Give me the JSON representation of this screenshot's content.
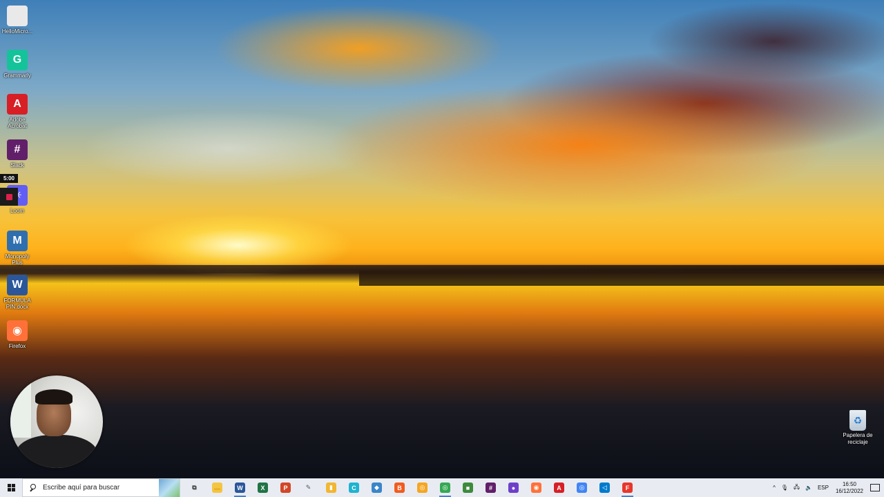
{
  "desktop": {
    "icons": [
      {
        "label": "HelloMicro...",
        "glyph": "",
        "color": "#e9e9e9",
        "icon": "file-icon"
      },
      {
        "label": "Grammarly",
        "glyph": "G",
        "color": "#15c39a",
        "icon": "grammarly-icon"
      },
      {
        "label": "Adobe Acrobat",
        "glyph": "A",
        "color": "#d81f26",
        "icon": "adobe-acrobat-icon"
      },
      {
        "label": "Slack",
        "glyph": "#",
        "color": "#611f69",
        "icon": "slack-icon"
      },
      {
        "label": "Loom",
        "glyph": "✳",
        "color": "#625df5",
        "icon": "loom-icon"
      },
      {
        "label": "Monopoly Plus",
        "glyph": "M",
        "color": "#2f6fb0",
        "icon": "monopoly-icon"
      },
      {
        "label": "FORMULA PIN.docx",
        "glyph": "W",
        "color": "#2b579a",
        "icon": "word-document-icon"
      },
      {
        "label": "Firefox",
        "glyph": "◉",
        "color": "#ff7139",
        "icon": "firefox-icon"
      }
    ],
    "recycle_bin": {
      "label": "Papelera de reciclaje",
      "icon": "recycle-bin-icon"
    },
    "loom_timer": "5:00"
  },
  "taskbar": {
    "search_placeholder": "Escribe aquí para buscar",
    "apps": [
      {
        "name": "task-view",
        "glyph": "⧉",
        "color": "#333",
        "bg": "transparent",
        "icon": "task-view-icon"
      },
      {
        "name": "file-explorer",
        "glyph": "▬",
        "color": "#e8b12a",
        "bg": "#f4c542",
        "icon": "folder-icon"
      },
      {
        "name": "word",
        "glyph": "W",
        "color": "#fff",
        "bg": "#2b579a",
        "icon": "word-icon",
        "active": true
      },
      {
        "name": "excel",
        "glyph": "X",
        "color": "#fff",
        "bg": "#217346",
        "icon": "excel-icon"
      },
      {
        "name": "powerpoint",
        "glyph": "P",
        "color": "#fff",
        "bg": "#d24726",
        "icon": "powerpoint-icon"
      },
      {
        "name": "tool",
        "glyph": "✎",
        "color": "#555",
        "bg": "transparent",
        "icon": "hammer-icon"
      },
      {
        "name": "notes",
        "glyph": "▮",
        "color": "#fff",
        "bg": "#f2b632",
        "icon": "notes-icon"
      },
      {
        "name": "canva",
        "glyph": "C",
        "color": "#fff",
        "bg": "#1fb3d1",
        "icon": "canva-icon"
      },
      {
        "name": "app-blue",
        "glyph": "◆",
        "color": "#fff",
        "bg": "#3a86c8",
        "icon": "app-icon"
      },
      {
        "name": "brave",
        "glyph": "B",
        "color": "#fff",
        "bg": "#f25b1f",
        "icon": "brave-icon"
      },
      {
        "name": "chrome-canary",
        "glyph": "◎",
        "color": "#fff",
        "bg": "#f4a623",
        "icon": "chrome-canary-icon"
      },
      {
        "name": "chrome",
        "glyph": "◎",
        "color": "#fff",
        "bg": "#34a853",
        "icon": "chrome-icon",
        "active": true
      },
      {
        "name": "cube",
        "glyph": "■",
        "color": "#fff",
        "bg": "#3d8a3d",
        "icon": "cube-icon"
      },
      {
        "name": "slack",
        "glyph": "#",
        "color": "#fff",
        "bg": "#611f69",
        "icon": "slack-icon"
      },
      {
        "name": "github",
        "glyph": "●",
        "color": "#fff",
        "bg": "#6e40c9",
        "icon": "github-icon"
      },
      {
        "name": "firefox",
        "glyph": "◉",
        "color": "#fff",
        "bg": "#ff7139",
        "icon": "firefox-icon"
      },
      {
        "name": "acrobat",
        "glyph": "A",
        "color": "#fff",
        "bg": "#d81f26",
        "icon": "acrobat-icon"
      },
      {
        "name": "chrome-2",
        "glyph": "◎",
        "color": "#fff",
        "bg": "#4285f4",
        "icon": "chrome-icon"
      },
      {
        "name": "vscode",
        "glyph": "◁",
        "color": "#fff",
        "bg": "#007acc",
        "icon": "vscode-icon"
      },
      {
        "name": "figma-like",
        "glyph": "F",
        "color": "#fff",
        "bg": "#e8372a",
        "icon": "app-red-icon",
        "active": true
      }
    ],
    "tray": {
      "chevron": "^",
      "mic": "🎙",
      "network": "🖧",
      "volume": "🔈",
      "language": "ESP",
      "time": "16:50",
      "date": "16/12/2022"
    }
  }
}
